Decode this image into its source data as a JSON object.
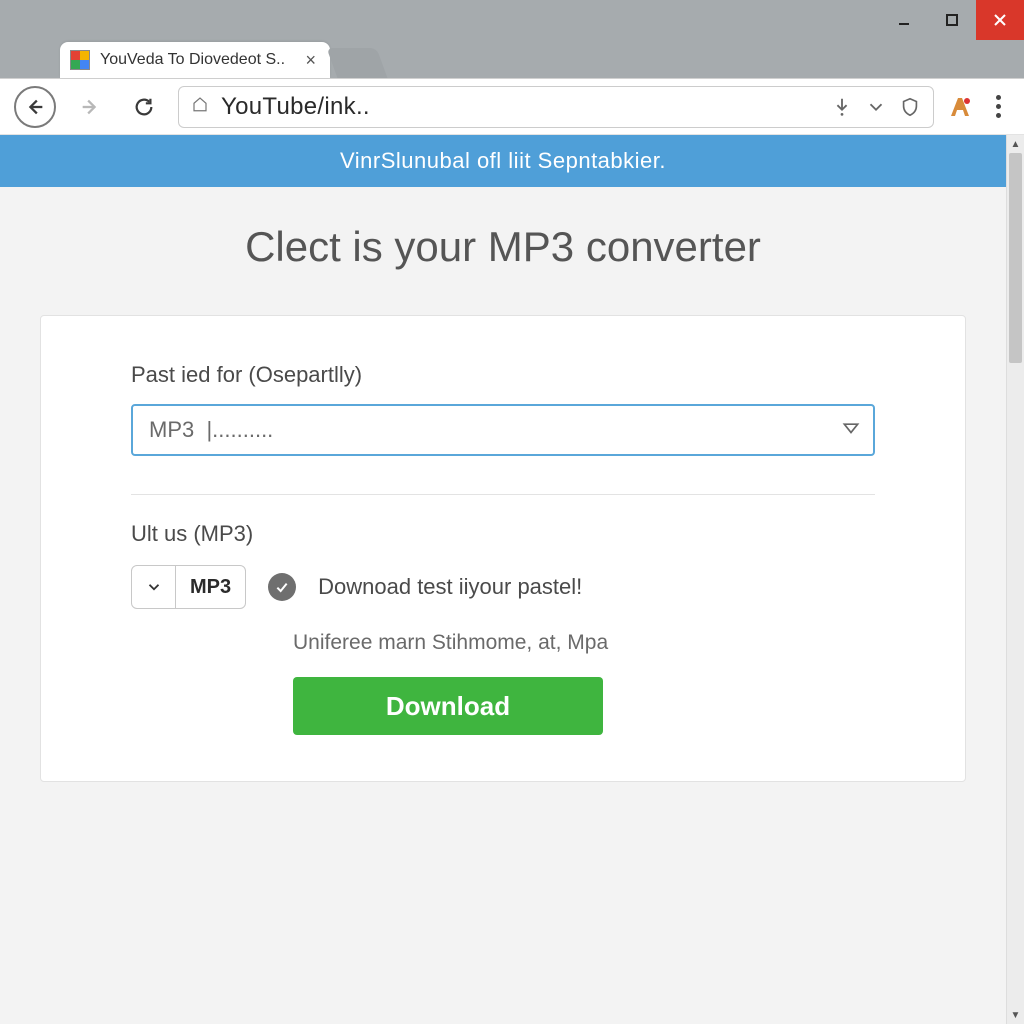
{
  "window": {
    "tab_title": "YouVeda To Diovedeot S..",
    "url": "YouTube/ink.."
  },
  "banner": {
    "text": "VinrSlunubal ofl liit Sepntabkier."
  },
  "page": {
    "heading": "Clect is your MP3 converter"
  },
  "form": {
    "url_label": "Past ied for (Osepartlly)",
    "url_input_value": "MP3  |..........",
    "format_label": "Ult us (MP3)",
    "format_value": "MP3",
    "status_text": "Downoad test iiyour pastel!",
    "subnote": "Uniferee marn Stihmome, at, Mpa",
    "download_label": "Download"
  },
  "colors": {
    "accent_blue": "#4f9fd8",
    "input_border": "#5aa7da",
    "download_green": "#3fb53f",
    "close_red": "#d9372a"
  }
}
